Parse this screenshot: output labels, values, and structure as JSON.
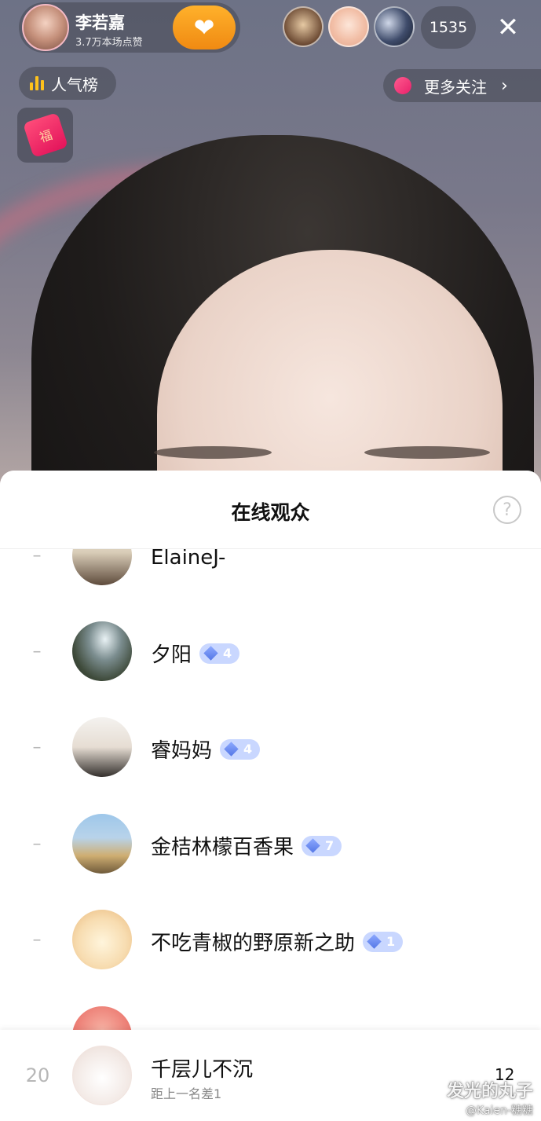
{
  "host": {
    "name": "李若嘉",
    "likes": "3.7万本场点赞"
  },
  "top_bar": {
    "viewer_count": "1535",
    "close_glyph": "✕",
    "heart_glyph": "❤"
  },
  "rank_button": {
    "label": "人气榜"
  },
  "follow_button": {
    "label": "更多关注",
    "chevron": "›"
  },
  "red_packet": {
    "glyph": "福"
  },
  "sheet": {
    "title": "在线观众",
    "help_glyph": "?"
  },
  "audience": [
    {
      "rank": "–",
      "name": "ElaineJ-",
      "badge": null,
      "avatar": "degas-avatar"
    },
    {
      "rank": "–",
      "name": "夕阳",
      "badge": "4",
      "avatar": "waterfall-avatar"
    },
    {
      "rank": "–",
      "name": "睿妈妈",
      "badge": "4",
      "avatar": "couple-avatar"
    },
    {
      "rank": "–",
      "name": "金桔林檬百香果",
      "badge": "7",
      "avatar": "jar-avatar"
    },
    {
      "rank": "–",
      "name": "不吃青椒的野原新之助",
      "badge": "1",
      "avatar": "cartoon-avatar"
    },
    {
      "rank": "",
      "name": "",
      "badge": null,
      "avatar": "peach-avatar"
    }
  ],
  "me": {
    "rank": "20",
    "name": "千层儿不沉",
    "sub": "距上一名差1",
    "score": "12"
  },
  "watermark": {
    "line1": "发光的丸子",
    "line2": "@Kaien-糖糖"
  },
  "colors": {
    "badge_bg": "#c9d7ff",
    "rank_bars": "#ffc21c",
    "heart_btn": "#f6a01f",
    "follow_dot": "#e8206a"
  }
}
